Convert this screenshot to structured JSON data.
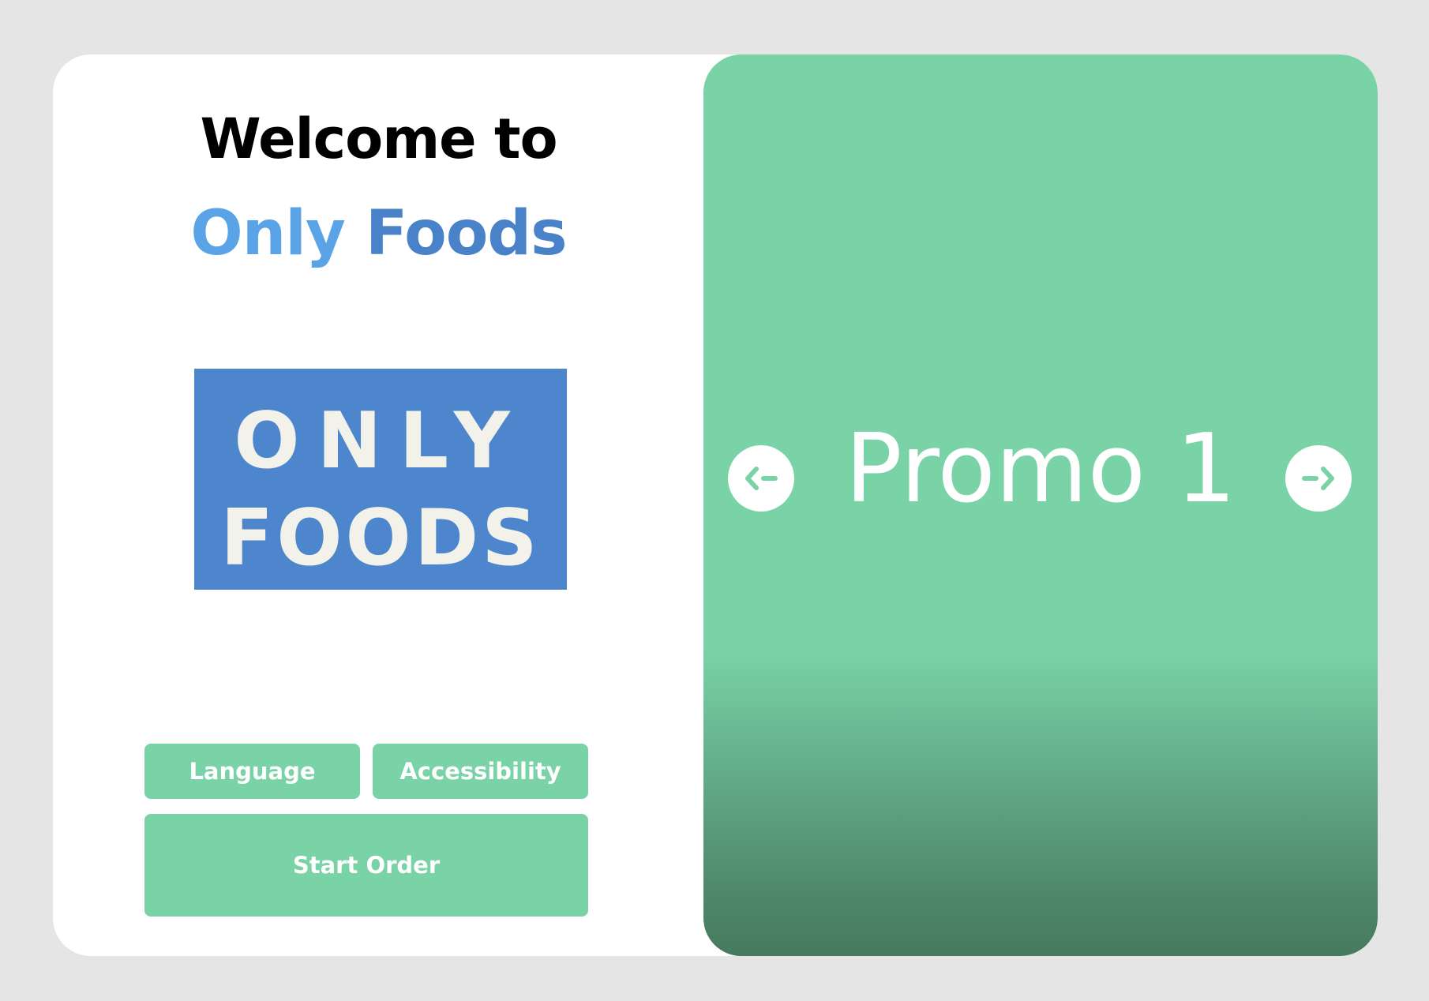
{
  "welcome": {
    "line1": "Welcome to",
    "brand_word1": "Only",
    "brand_word2": "Foods"
  },
  "logo": {
    "text_line1": "ONLY",
    "text_line2": "FOODS",
    "background_color": "#4d86cd",
    "text_color": "#f3f2ea"
  },
  "actions": {
    "language_label": "Language",
    "accessibility_label": "Accessibility",
    "start_order_label": "Start Order"
  },
  "promo": {
    "title": "Promo 1",
    "prev_icon": "arrow-left-circle-icon",
    "next_icon": "arrow-right-circle-icon"
  },
  "colors": {
    "accent_green": "#79d3a7",
    "brand_blue_light": "#5aa3e6",
    "brand_blue_dark": "#4a82c9",
    "background": "#e5e5e5"
  }
}
